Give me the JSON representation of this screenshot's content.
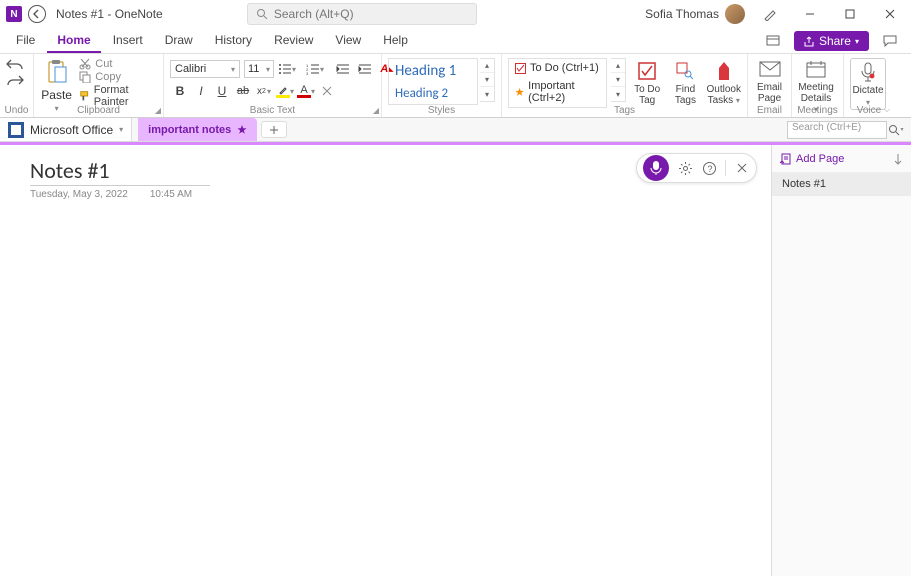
{
  "titlebar": {
    "app_icon_letter": "N",
    "doc_title": "Notes #1  -  OneNote",
    "search_placeholder": "Search (Alt+Q)",
    "user_name": "Sofia Thomas"
  },
  "tabs": {
    "items": [
      "File",
      "Home",
      "Insert",
      "Draw",
      "History",
      "Review",
      "View",
      "Help"
    ],
    "active_index": 1,
    "share_label": "Share"
  },
  "ribbon": {
    "undo": {
      "group_label": "Undo"
    },
    "clipboard": {
      "group_label": "Clipboard",
      "paste": "Paste",
      "cut": "Cut",
      "copy": "Copy",
      "format_painter": "Format Painter"
    },
    "basic_text": {
      "group_label": "Basic Text",
      "font_name": "Calibri",
      "font_size": "11"
    },
    "styles": {
      "group_label": "Styles",
      "heading1": "Heading 1",
      "heading2": "Heading 2"
    },
    "tags": {
      "group_label": "Tags",
      "todo": "To Do (Ctrl+1)",
      "important": "Important (Ctrl+2)",
      "todo_tag": "To Do Tag",
      "find_tags": "Find Tags",
      "outlook_tasks": "Outlook Tasks"
    },
    "email": {
      "group_label": "Email",
      "email_page": "Email Page"
    },
    "meetings": {
      "group_label": "Meetings",
      "meeting_details": "Meeting Details"
    },
    "voice": {
      "group_label": "Voice",
      "dictate": "Dictate"
    }
  },
  "notebook_bar": {
    "notebook_name": "Microsoft Office",
    "section_name": "important notes",
    "search_placeholder": "Search (Ctrl+E)"
  },
  "canvas": {
    "title": "Notes #1",
    "date": "Tuesday, May 3, 2022",
    "time": "10:45 AM"
  },
  "page_panel": {
    "add_page": "Add Page",
    "pages": [
      "Notes #1"
    ]
  }
}
